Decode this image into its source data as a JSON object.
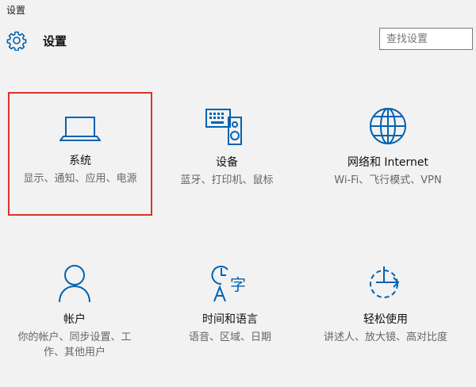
{
  "window": {
    "title": "设置"
  },
  "header": {
    "title": "设置",
    "icon": "gear-icon"
  },
  "search": {
    "placeholder": "查找设置"
  },
  "accent_color": "#0063b1",
  "selection_color": "#d9342b",
  "tiles": [
    {
      "name": "系统",
      "desc": "显示、通知、应用、电源",
      "icon": "laptop-icon",
      "selected": true
    },
    {
      "name": "设备",
      "desc": "蓝牙、打印机、鼠标",
      "icon": "devices-icon",
      "selected": false
    },
    {
      "name": "网络和 Internet",
      "desc": "Wi-Fi、飞行模式、VPN",
      "icon": "globe-icon",
      "selected": false
    },
    {
      "name": "帐户",
      "desc": "你的帐户、同步设置、工作、其他用户",
      "icon": "person-icon",
      "selected": false
    },
    {
      "name": "时间和语言",
      "desc": "语音、区域、日期",
      "icon": "time-language-icon",
      "selected": false
    },
    {
      "name": "轻松使用",
      "desc": "讲述人、放大镜、高对比度",
      "icon": "ease-of-access-icon",
      "selected": false
    }
  ]
}
